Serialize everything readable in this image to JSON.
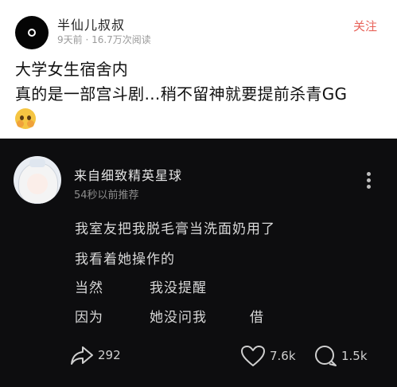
{
  "post": {
    "author": "半仙儿叔叔",
    "meta": "9天前 · 16.7万次阅读",
    "follow_label": "关注",
    "lines": [
      "大学女生宿舍内",
      "真的是一部宫斗剧…稍不留神就要提前杀青GG"
    ]
  },
  "comment": {
    "author": "来自细致精英星球",
    "meta": "54秒以前推荐",
    "line1": "我室友把我脱毛膏当洗面奶用了",
    "line2": "我看着她操作的",
    "line3a": "当然",
    "line3b": "我没提醒",
    "line4a": "因为",
    "line4b": "她没问我",
    "line4c": "借",
    "share_count": "292",
    "like_count": "7.6k",
    "reply_count": "1.5k"
  },
  "colors": {
    "follow": "#e8635a",
    "dark_bg": "#0d0d0f"
  },
  "icons": [
    "avatar",
    "emoji-pleading",
    "more-vertical-icon",
    "share-icon",
    "heart-icon",
    "comment-icon"
  ]
}
